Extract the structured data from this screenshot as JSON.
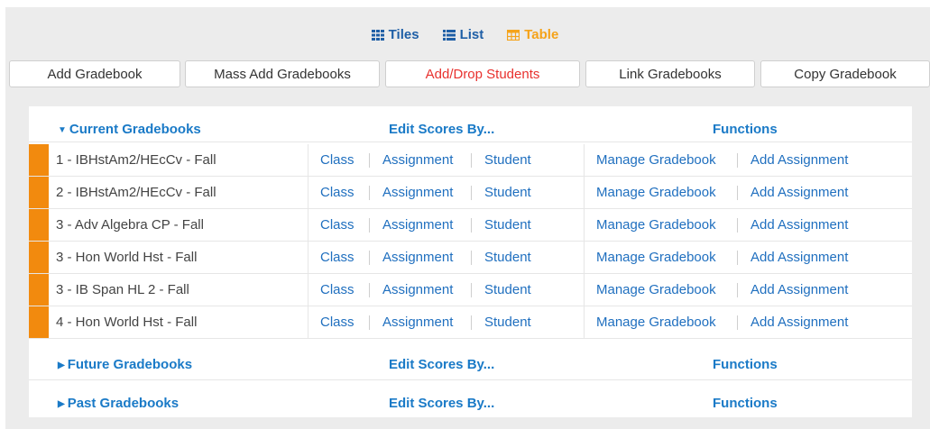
{
  "view_toggle": {
    "tiles": "Tiles",
    "list": "List",
    "table": "Table",
    "active": "table",
    "accent_color": "#f5a31a",
    "link_color": "#1f5fa6"
  },
  "toolbar": {
    "add_gradebook": "Add Gradebook",
    "mass_add": "Mass Add Gradebooks",
    "add_drop": "Add/Drop Students",
    "link_gradebooks": "Link Gradebooks",
    "copy_gradebook": "Copy Gradebook"
  },
  "headers": {
    "current": "Current Gradebooks",
    "future": "Future Gradebooks",
    "past": "Past Gradebooks",
    "edit_scores": "Edit Scores By...",
    "functions": "Functions"
  },
  "row_links": {
    "class": "Class",
    "assignment": "Assignment",
    "student": "Student",
    "manage": "Manage Gradebook",
    "add_assignment": "Add Assignment"
  },
  "gradebooks": [
    {
      "name": "1 - IBHstAm2/HEcCv - Fall"
    },
    {
      "name": "2 - IBHstAm2/HEcCv - Fall"
    },
    {
      "name": "3 - Adv Algebra CP - Fall"
    },
    {
      "name": "3 - Hon World Hst - Fall"
    },
    {
      "name": "3 - IB Span HL 2 - Fall"
    },
    {
      "name": "4 - Hon World Hst - Fall"
    }
  ],
  "colors": {
    "gradebook_bar": "#f28a0e",
    "section_header": "#1a7ac7",
    "link": "#1f6fbf",
    "add_drop_text": "#e8312e"
  },
  "icons": {
    "tiles": "grid-icon",
    "list": "list-icon",
    "table": "table-icon",
    "expanded": "triangle-down-icon",
    "collapsed": "triangle-right-icon"
  }
}
